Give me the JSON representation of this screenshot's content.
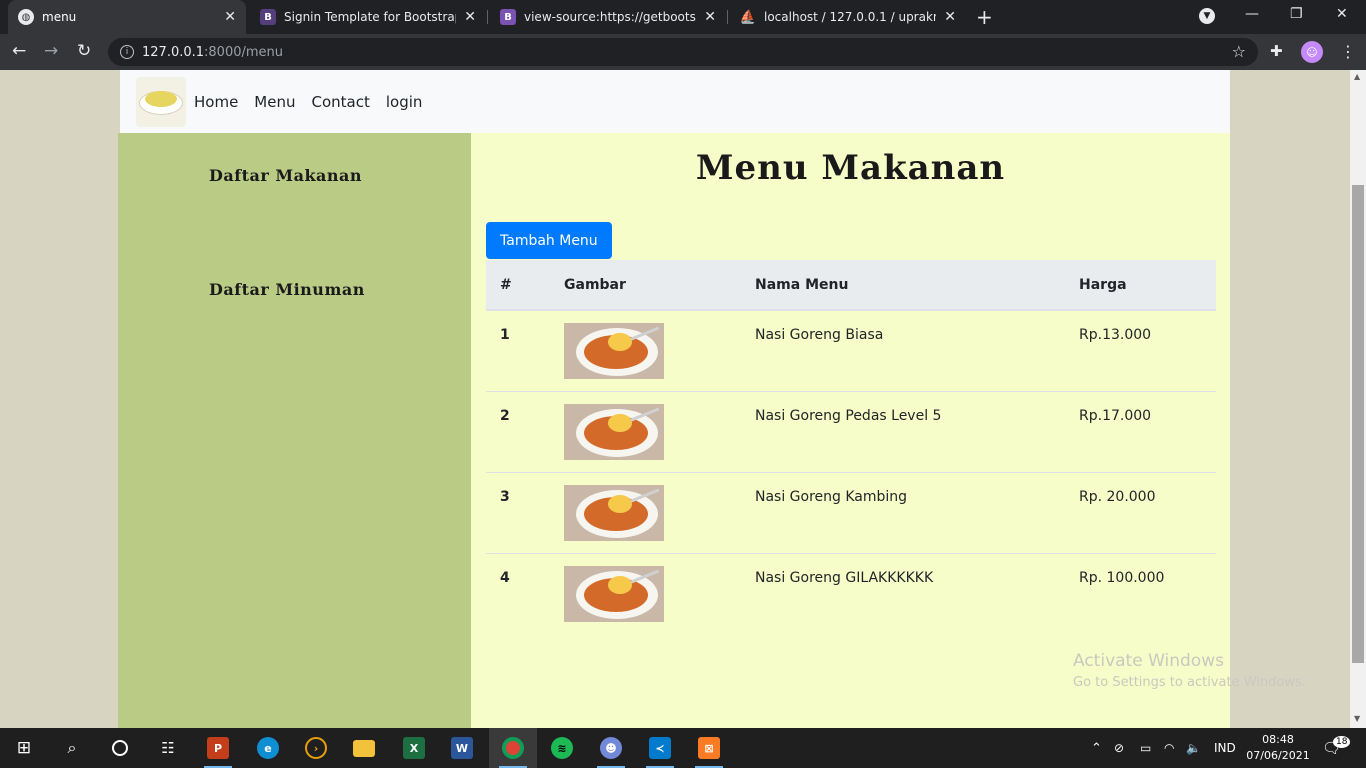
{
  "browser": {
    "tabs": [
      {
        "title": "menu",
        "favicon": "globe-icon",
        "active": true
      },
      {
        "title": "Signin Template for Bootstrap",
        "favicon": "bootstrap-icon",
        "active": false
      },
      {
        "title": "view-source:https://getbootstrap",
        "favicon": "bootstrap-icon",
        "active": false
      },
      {
        "title": "localhost / 127.0.0.1 / upraknasi /",
        "favicon": "phpmyadmin-icon",
        "active": false
      }
    ],
    "url_host": "127.0.0.1",
    "url_path": ":8000/menu"
  },
  "navbar": {
    "links": [
      "Home",
      "Menu",
      "Contact",
      "login"
    ]
  },
  "sidebar": {
    "items": [
      "Daftar Makanan",
      "Daftar Minuman"
    ]
  },
  "main": {
    "title": "Menu Makanan",
    "add_button": "Tambah Menu",
    "table": {
      "headers": [
        "#",
        "Gambar",
        "Nama Menu",
        "Harga"
      ],
      "rows": [
        {
          "no": "1",
          "name": "Nasi Goreng Biasa",
          "price": "Rp.13.000"
        },
        {
          "no": "2",
          "name": "Nasi Goreng Pedas Level 5",
          "price": "Rp.17.000"
        },
        {
          "no": "3",
          "name": "Nasi Goreng Kambing",
          "price": "Rp. 20.000"
        },
        {
          "no": "4",
          "name": "Nasi Goreng GILAKKKKKK",
          "price": "Rp. 100.000"
        }
      ]
    }
  },
  "watermark": {
    "line1": "Activate Windows",
    "line2": "Go to Settings to activate Windows."
  },
  "taskbar": {
    "lang": "IND",
    "time": "08:48",
    "date": "07/06/2021",
    "notifications": "18"
  },
  "colors": {
    "sidebar_bg": "#bacb85",
    "main_bg": "#f7fdc8",
    "primary_button": "#007bff"
  }
}
